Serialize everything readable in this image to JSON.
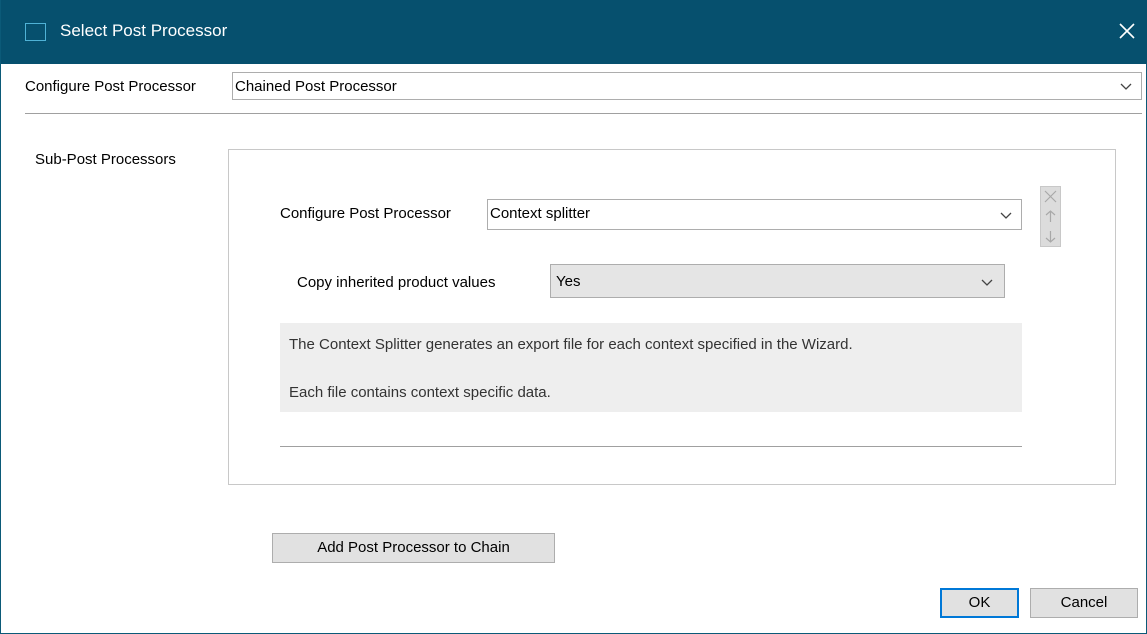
{
  "window": {
    "title": "Select Post Processor"
  },
  "top": {
    "label": "Configure Post Processor",
    "value": "Chained Post Processor"
  },
  "sub": {
    "label": "Sub-Post Processors",
    "processor_label": "Configure Post Processor",
    "processor_value": "Context splitter",
    "copy_label": "Copy inherited product values",
    "copy_value": "Yes",
    "description_line1": "The Context Splitter generates an export file for each context specified in the Wizard.",
    "description_line2": "Each file contains context specific data."
  },
  "buttons": {
    "add": "Add Post Processor to Chain",
    "ok": "OK",
    "cancel": "Cancel"
  },
  "icons": {
    "close": "close-icon",
    "remove": "x-icon",
    "up": "arrow-up-icon",
    "down": "arrow-down-icon",
    "dropdown": "chevron-down-icon"
  },
  "colors": {
    "titlebar": "#06506e",
    "default_button_border": "#0078d7"
  }
}
